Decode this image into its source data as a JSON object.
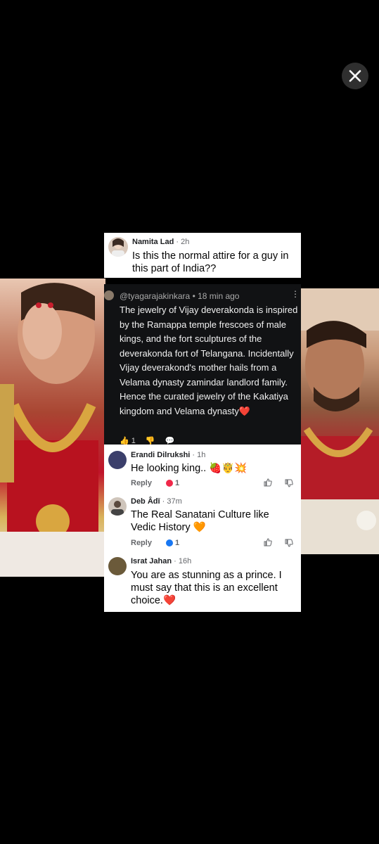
{
  "close_label": "✕",
  "top_comment": {
    "name": "Namita Lad",
    "time": "2h",
    "text": "Is this the normal attire for a guy in this part of India??"
  },
  "dark_comment": {
    "handle": "@tyagarajakinkara",
    "time": "18 min ago",
    "text": "The jewelry of Vijay deverakonda is inspired by the Ramappa temple frescoes of male kings, and the fort sculptures of the deverakonda fort of Telangana. Incidentally Vijay deverakond's mother hails from a Velama dynasty zamindar landlord family. Hence the curated jewelry of the Kakatiya kingdom and Velama dynasty",
    "emoji": "❤️",
    "likes": "1"
  },
  "comments": [
    {
      "name": "Erandi Dilrukshi",
      "time": "1h",
      "text": "He looking king..",
      "emoji": "🍓🤴💥",
      "reply": "Reply",
      "count": "1",
      "react_color": "#f02849"
    },
    {
      "name": "Deb Âdī",
      "time": "37m",
      "text": "The Real Sanatani Culture like Vedic History",
      "emoji": "🧡",
      "reply": "Reply",
      "count": "1",
      "react_color": "#1877f2"
    },
    {
      "name": "Israt Jahan",
      "time": "16h",
      "text": "You are as stunning as a prince. I must say that this is an excellent choice.",
      "emoji": "❤️"
    }
  ],
  "colors": {
    "background": "#000000",
    "card": "#ffffff",
    "dark_card": "#111214"
  }
}
